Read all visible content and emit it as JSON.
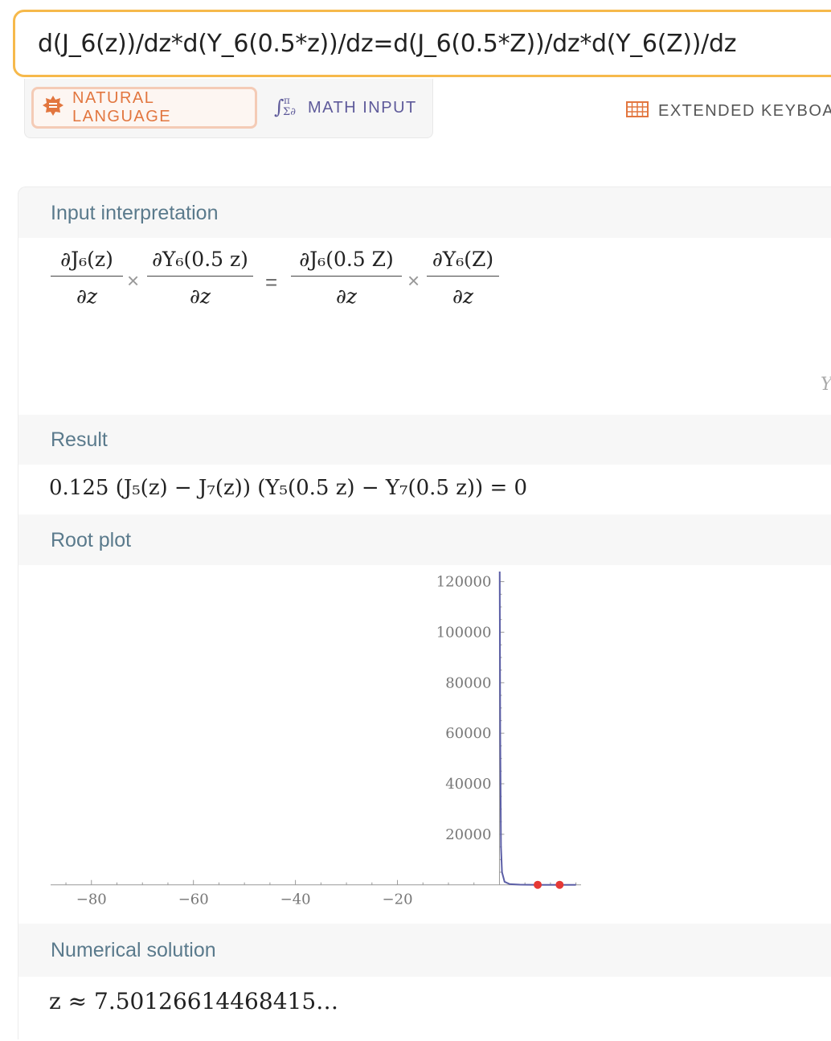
{
  "search": {
    "query": "d(J_6(z))/dz*d(Y_6(0.5*z))/dz=d(J_6(0.5*Z))/dz*d(Y_6(Z))/dz"
  },
  "modes": {
    "natural_language": "NATURAL LANGUAGE",
    "math_input": "MATH INPUT",
    "extended_keyboard": "EXTENDED KEYBOAR"
  },
  "pods": {
    "input": {
      "title": "Input interpretation",
      "terms": [
        {
          "num": "∂J₆(z)",
          "den": "∂z"
        },
        {
          "num": "∂Y₆(0.5 z)",
          "den": "∂z"
        },
        {
          "num": "∂J₆(0.5 Z)",
          "den": "∂z"
        },
        {
          "num": "∂Y₆(Z)",
          "den": "∂z"
        }
      ],
      "times": "×",
      "equals": "=",
      "clipped_note": "Yₙ("
    },
    "result": {
      "title": "Result",
      "expression": "0.125 (J₅(z) − J₇(z)) (Y₅(0.5 z) − Y₇(0.5 z)) = 0"
    },
    "root_plot": {
      "title": "Root plot"
    },
    "numerical": {
      "title": "Numerical solution",
      "value": "z ≈ 7.50126614468415…"
    }
  },
  "chart_data": {
    "type": "line",
    "title": "",
    "xlabel": "",
    "ylabel": "",
    "xlim": [
      -88,
      16
    ],
    "ylim": [
      -2000,
      124000
    ],
    "x_ticks": [
      -80,
      -60,
      -40,
      -20
    ],
    "x_tick_labels": [
      "−80",
      "−60",
      "−40",
      "−20"
    ],
    "y_ticks": [
      20000,
      40000,
      60000,
      80000,
      100000,
      120000
    ],
    "y_tick_labels": [
      "20000",
      "40000",
      "60000",
      "80000",
      "100000",
      "120000"
    ],
    "series": [
      {
        "color": "#5b5ea6",
        "x": [
          0.05,
          0.15,
          0.3,
          0.5,
          1,
          2,
          4,
          7.5,
          10,
          12,
          15
        ],
        "y": [
          124000,
          60000,
          15000,
          5000,
          1200,
          300,
          50,
          0,
          0,
          0,
          0
        ]
      }
    ],
    "roots": [
      {
        "x": 7.50126614468415,
        "y": 0
      },
      {
        "x": 11.8,
        "y": 0
      }
    ],
    "root_color": "#e53935",
    "grid": false
  }
}
